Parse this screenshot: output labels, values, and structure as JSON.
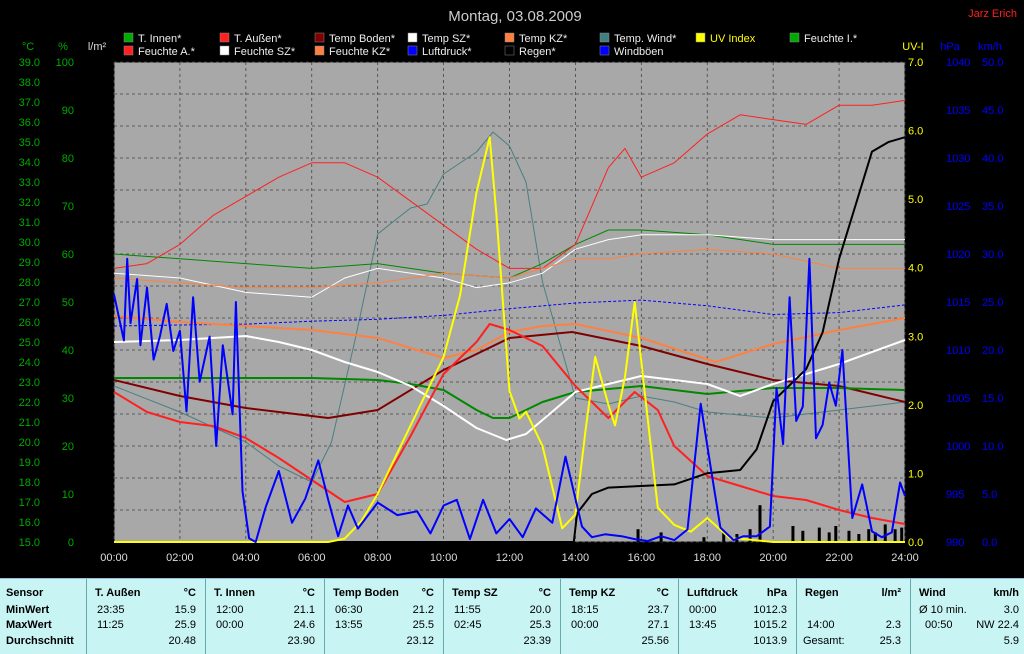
{
  "header": {
    "title": "Montag, 03.08.2009",
    "author": "Jarz Erich"
  },
  "legend": [
    {
      "label": "T. Innen*",
      "color": "#00aa00"
    },
    {
      "label": "T. Außen*",
      "color": "#ff2020"
    },
    {
      "label": "Temp Boden*",
      "color": "#800000"
    },
    {
      "label": "Temp SZ*",
      "color": "#ffffff"
    },
    {
      "label": "Temp KZ*",
      "color": "#ff8040"
    },
    {
      "label": "Temp. Wind*",
      "color": "#408080"
    },
    {
      "label": "UV Index",
      "color": "#ffff00"
    },
    {
      "label": "Feuchte I.*",
      "color": "#00aa00"
    },
    {
      "label": "Feuchte A.*",
      "color": "#ff2020"
    },
    {
      "label": "Feuchte SZ*",
      "color": "#ffffff"
    },
    {
      "label": "Feuchte KZ*",
      "color": "#ff8040"
    },
    {
      "label": "Luftdruck*",
      "color": "#0000ff"
    },
    {
      "label": "Regen*",
      "color": "#000000"
    },
    {
      "label": "Windböen",
      "color": "#0000ff"
    }
  ],
  "axes": {
    "temp": {
      "unit": "°C",
      "color": "#00aa00",
      "min": 15.0,
      "max": 39.0,
      "step": 1.0
    },
    "humidity": {
      "unit": "%",
      "color": "#00aa00",
      "min": 0,
      "max": 100,
      "step": 10
    },
    "rain": {
      "unit": "l/m²",
      "color": "#000000",
      "min": 0.0,
      "max": 30.0,
      "step": 2.0
    },
    "uv": {
      "unit": "UV-I",
      "color": "#ffff00",
      "min": 0.0,
      "max": 7.0,
      "step": 1.0
    },
    "pressure": {
      "unit": "hPa",
      "color": "#0000ff",
      "min": 990,
      "max": 1040,
      "step": 5
    },
    "wind": {
      "unit": "km/h",
      "color": "#0000ff",
      "min": 0.0,
      "max": 50.0,
      "step": 5.0
    },
    "time_labels": [
      "00:00",
      "02:00",
      "04:00",
      "06:00",
      "08:00",
      "10:00",
      "12:00",
      "14:00",
      "16:00",
      "18:00",
      "20:00",
      "22:00",
      "24:00"
    ]
  },
  "chart_data": {
    "type": "line",
    "x_unit": "hours",
    "x_range": [
      0,
      24
    ],
    "grid": true,
    "series": [
      {
        "name": "T. Außen*",
        "axis": "temp",
        "color": "#ff2020",
        "width": 2,
        "x": [
          0,
          1,
          2,
          3,
          4,
          5,
          6,
          7,
          8,
          9,
          10,
          11,
          11.4,
          12,
          13,
          14,
          15,
          15.8,
          16.5,
          17,
          18,
          19,
          20,
          21,
          22,
          23,
          24
        ],
        "y": [
          22.5,
          21.5,
          21.0,
          20.8,
          20.2,
          19.2,
          18.1,
          17.0,
          17.4,
          20.3,
          23.4,
          25.0,
          25.9,
          25.6,
          24.8,
          22.8,
          21.2,
          22.5,
          21.6,
          19.8,
          18.3,
          17.8,
          17.3,
          17.1,
          16.6,
          16.2,
          15.9
        ]
      },
      {
        "name": "T. Innen*",
        "axis": "temp",
        "color": "#008800",
        "width": 2,
        "x": [
          0,
          2,
          4,
          6,
          8,
          9,
          10,
          11,
          11.5,
          12,
          13,
          14,
          16,
          18,
          20,
          22,
          23.95,
          24
        ],
        "y": [
          23.2,
          23.2,
          23.2,
          23.2,
          23.1,
          22.9,
          22.6,
          21.6,
          21.2,
          21.2,
          22.0,
          22.5,
          22.8,
          22.4,
          22.7,
          22.7,
          22.6,
          22.6
        ]
      },
      {
        "name": "Temp Boden*",
        "axis": "temp",
        "color": "#800000",
        "width": 2,
        "x": [
          0,
          2,
          4,
          6,
          6.5,
          8,
          10,
          12,
          13.9,
          14.5,
          16,
          18,
          20,
          22,
          24
        ],
        "y": [
          23.1,
          22.3,
          21.7,
          21.3,
          21.2,
          21.6,
          23.6,
          25.2,
          25.5,
          25.3,
          24.8,
          23.9,
          23.1,
          22.8,
          22.0
        ]
      },
      {
        "name": "Temp SZ*",
        "axis": "temp",
        "color": "#ffffff",
        "width": 2,
        "x": [
          0,
          2,
          4,
          5,
          6,
          7,
          8,
          9,
          10,
          11,
          11.9,
          12.5,
          14,
          16,
          18,
          19,
          20,
          22,
          24
        ],
        "y": [
          25.0,
          25.1,
          25.3,
          25.0,
          24.6,
          24.0,
          23.5,
          22.8,
          21.8,
          20.7,
          20.1,
          20.4,
          22.5,
          23.3,
          22.9,
          22.3,
          22.9,
          23.9,
          25.1
        ]
      },
      {
        "name": "Temp KZ*",
        "axis": "temp",
        "color": "#ff8040",
        "width": 2,
        "x": [
          0,
          2,
          4,
          6,
          8,
          10,
          11,
          12,
          13,
          14,
          16,
          18.25,
          20,
          22,
          24
        ],
        "y": [
          26.3,
          26.0,
          25.8,
          25.6,
          25.2,
          24.2,
          24.6,
          25.5,
          25.8,
          25.9,
          25.2,
          24.0,
          24.9,
          25.6,
          26.2
        ]
      },
      {
        "name": "Temp. Wind*",
        "axis": "temp",
        "color": "#4a8080",
        "width": 1,
        "x": [
          0,
          2,
          4,
          5,
          6,
          6.6,
          7.3,
          8,
          9,
          9.5,
          10,
          11,
          11.5,
          12,
          12.5,
          13,
          14,
          15,
          16,
          17,
          18,
          20,
          22,
          24
        ],
        "y": [
          22.8,
          21.5,
          20.0,
          18.8,
          18.0,
          20.0,
          25.0,
          30.4,
          31.7,
          31.9,
          33.4,
          34.5,
          35.5,
          34.8,
          33.0,
          28.0,
          22.2,
          21.9,
          22.3,
          22.0,
          21.5,
          21.2,
          21.6,
          22.0
        ]
      },
      {
        "name": "Feuchte A.*",
        "axis": "humidity",
        "color": "#ff2020",
        "width": 1,
        "x": [
          0,
          1,
          2,
          3,
          4,
          5,
          6,
          7,
          8,
          9,
          10,
          11,
          12,
          13,
          14,
          15,
          15.5,
          16,
          17,
          18,
          19,
          20,
          21,
          22,
          23,
          24
        ],
        "y": [
          57,
          58,
          62,
          68,
          72,
          76,
          79,
          79,
          76,
          71,
          66,
          61,
          57,
          57,
          62,
          78,
          82,
          76,
          79,
          85,
          89,
          88,
          87,
          91,
          91,
          92
        ]
      },
      {
        "name": "Feuchte I.*",
        "axis": "humidity",
        "color": "#008800",
        "width": 1,
        "x": [
          0,
          2,
          4,
          6,
          8,
          10,
          12,
          13,
          14,
          15,
          16,
          18,
          20,
          22,
          24
        ],
        "y": [
          60,
          59,
          58,
          57,
          58,
          56,
          55,
          58,
          62,
          65,
          65,
          64,
          62,
          62,
          62
        ]
      },
      {
        "name": "Feuchte SZ*",
        "axis": "humidity",
        "color": "#ffffff",
        "width": 1,
        "x": [
          0,
          2,
          4,
          6,
          7,
          8,
          10,
          11,
          12,
          13,
          14,
          15,
          16,
          18,
          20,
          22,
          24
        ],
        "y": [
          56,
          55,
          52,
          51,
          55,
          57,
          55,
          53,
          54,
          56,
          61,
          63,
          64,
          64,
          63,
          63,
          63
        ]
      },
      {
        "name": "Feuchte KZ*",
        "axis": "humidity",
        "color": "#ff8040",
        "width": 1,
        "x": [
          0,
          2,
          4,
          6,
          8,
          10,
          12,
          13,
          14,
          15,
          16,
          18,
          20,
          22,
          24
        ],
        "y": [
          55,
          54,
          53,
          53,
          54,
          56,
          55,
          57,
          59,
          59,
          60,
          61,
          60,
          57,
          57
        ]
      },
      {
        "name": "Luftdruck*",
        "axis": "pressure",
        "color": "#0000ff",
        "width": 1,
        "dash": "3,2",
        "x": [
          0,
          2,
          4,
          6,
          8,
          10,
          12,
          14,
          16,
          18,
          20,
          22,
          24
        ],
        "y": [
          1012.5,
          1012.6,
          1012.7,
          1013.0,
          1013.2,
          1013.6,
          1014.3,
          1014.9,
          1015.2,
          1014.6,
          1013.7,
          1013.9,
          1014.7
        ]
      },
      {
        "name": "UV Index",
        "axis": "uv",
        "color": "#ffff00",
        "width": 2,
        "x": [
          0,
          6.5,
          7,
          7.5,
          8,
          9,
          10,
          10.5,
          11,
          11.2,
          11.4,
          11.6,
          12,
          12.3,
          12.5,
          13,
          13.6,
          14,
          14.3,
          14.6,
          15,
          15.2,
          15.5,
          15.8,
          16.1,
          16.5,
          17,
          17.5,
          18,
          18.7,
          19,
          20,
          24
        ],
        "y": [
          0,
          0,
          0.05,
          0.3,
          0.7,
          1.7,
          2.7,
          3.6,
          5.1,
          5.5,
          5.9,
          4.8,
          2.2,
          1.8,
          1.9,
          1.4,
          0.2,
          0.4,
          1.6,
          2.7,
          2.0,
          1.7,
          2.4,
          3.5,
          2.2,
          0.5,
          0.25,
          0.15,
          0.35,
          0.05,
          0.05,
          0,
          0
        ]
      },
      {
        "name": "Regen*",
        "axis": "rain",
        "color": "#000000",
        "width": 2,
        "x": [
          0,
          13.95,
          14.05,
          14.5,
          15,
          16,
          17,
          18,
          19,
          19.5,
          20,
          21,
          21.5,
          22,
          23,
          23.5,
          24
        ],
        "y": [
          0,
          0,
          1.8,
          3.0,
          3.4,
          3.5,
          3.6,
          4.3,
          4.5,
          5.8,
          8.8,
          10.8,
          13.1,
          17.7,
          24.4,
          25.0,
          25.3
        ]
      },
      {
        "name": "Windböen",
        "axis": "wind",
        "color": "#0000ff",
        "width": 2,
        "x": [
          0,
          0.3,
          0.4,
          0.5,
          0.7,
          0.8,
          1.0,
          1.2,
          1.4,
          1.6,
          1.8,
          2.0,
          2.2,
          2.4,
          2.6,
          2.9,
          3.1,
          3.3,
          3.6,
          3.7,
          3.9,
          4.1,
          4.3,
          4.6,
          5.0,
          5.4,
          5.8,
          6.2,
          6.5,
          6.8,
          7.1,
          7.4,
          8.0,
          8.6,
          9.2,
          9.6,
          10.0,
          10.4,
          10.8,
          11.2,
          11.6,
          12.0,
          12.4,
          12.8,
          13.3,
          13.7,
          14.2,
          14.5,
          14.9,
          15.4,
          15.8,
          16.2,
          16.6,
          17.0,
          17.4,
          17.8,
          18.1,
          18.4,
          18.8,
          19.1,
          19.5,
          19.9,
          20.1,
          20.3,
          20.5,
          20.7,
          20.9,
          21.1,
          21.3,
          21.5,
          21.7,
          21.9,
          22.1,
          22.4,
          22.7,
          23.0,
          23.3,
          23.6,
          23.85,
          24
        ],
        "y": [
          25.8,
          21.0,
          29.5,
          22.8,
          27.4,
          20.5,
          26.5,
          19.0,
          21.5,
          24.8,
          19.9,
          22.0,
          13.6,
          25.5,
          16.7,
          21.4,
          10.0,
          20.5,
          13.3,
          25.0,
          5.3,
          0.4,
          0,
          3.6,
          7.4,
          2.0,
          4.5,
          8.5,
          4.4,
          0.6,
          3.8,
          1.4,
          4.1,
          2.8,
          3.2,
          0.9,
          3.8,
          4.4,
          0.3,
          4.4,
          0.9,
          2.4,
          0.5,
          3.5,
          2.0,
          8.9,
          1.6,
          0.5,
          0.8,
          0.6,
          0.3,
          0.1,
          0.6,
          0.2,
          1.3,
          14.4,
          7.9,
          1.5,
          0.2,
          0.6,
          0.6,
          1.6,
          16.0,
          10.2,
          25.5,
          12.6,
          14.1,
          29.5,
          10.8,
          12.2,
          16.6,
          14.2,
          20.0,
          2.5,
          6.0,
          1.1,
          0.5,
          1.0,
          6.2,
          4.8
        ]
      }
    ],
    "rain_bars": {
      "x": [
        15.9,
        16.6,
        17.9,
        18.5,
        18.9,
        19.3,
        19.6,
        20.6,
        20.9,
        21.4,
        21.7,
        21.9,
        22.3,
        22.6,
        22.9,
        23.1,
        23.4,
        23.7,
        23.9
      ],
      "y": [
        0.8,
        0.6,
        0.3,
        0.6,
        0.5,
        0.8,
        2.3,
        1.0,
        0.7,
        0.9,
        0.6,
        1.0,
        0.7,
        0.5,
        0.8,
        0.6,
        1.1,
        0.8,
        0.9
      ]
    }
  },
  "stats": {
    "row_labels": {
      "sensor": "Sensor",
      "min": "MinWert",
      "max": "MaxWert",
      "avg": "Durchschnitt"
    },
    "columns": [
      {
        "title": "T. Außen",
        "unit": "°C",
        "min_time": "23:35",
        "min": "15.9",
        "max_time": "11:25",
        "max": "25.9",
        "avg": "20.48"
      },
      {
        "title": "T. Innen",
        "unit": "°C",
        "min_time": "12:00",
        "min": "21.1",
        "max_time": "00:00",
        "max": "24.6",
        "avg": "23.90"
      },
      {
        "title": "Temp Boden",
        "unit": "°C",
        "min_time": "06:30",
        "min": "21.2",
        "max_time": "13:55",
        "max": "25.5",
        "avg": "23.12"
      },
      {
        "title": "Temp SZ",
        "unit": "°C",
        "min_time": "11:55",
        "min": "20.0",
        "max_time": "02:45",
        "max": "25.3",
        "avg": "23.39"
      },
      {
        "title": "Temp KZ",
        "unit": "°C",
        "min_time": "18:15",
        "min": "23.7",
        "max_time": "00:00",
        "max": "27.1",
        "avg": "25.56"
      },
      {
        "title": "Luftdruck",
        "unit": "hPa",
        "min_time": "00:00",
        "min": "1012.3",
        "max_time": "13:45",
        "max": "1015.2",
        "avg": "1013.9"
      }
    ],
    "rain": {
      "title": "Regen",
      "unit": "l/m²",
      "min_time": "",
      "min": "",
      "max_time": "14:00",
      "max": "2.3",
      "avg_label": "Gesamt:",
      "avg": "25.3"
    },
    "wind": {
      "title": "Wind",
      "unit": "km/h",
      "min_label": "Ø 10 min.",
      "min": "3.0",
      "max_time": "00:50",
      "max": "NW 22.4",
      "avg": "5.9"
    }
  }
}
